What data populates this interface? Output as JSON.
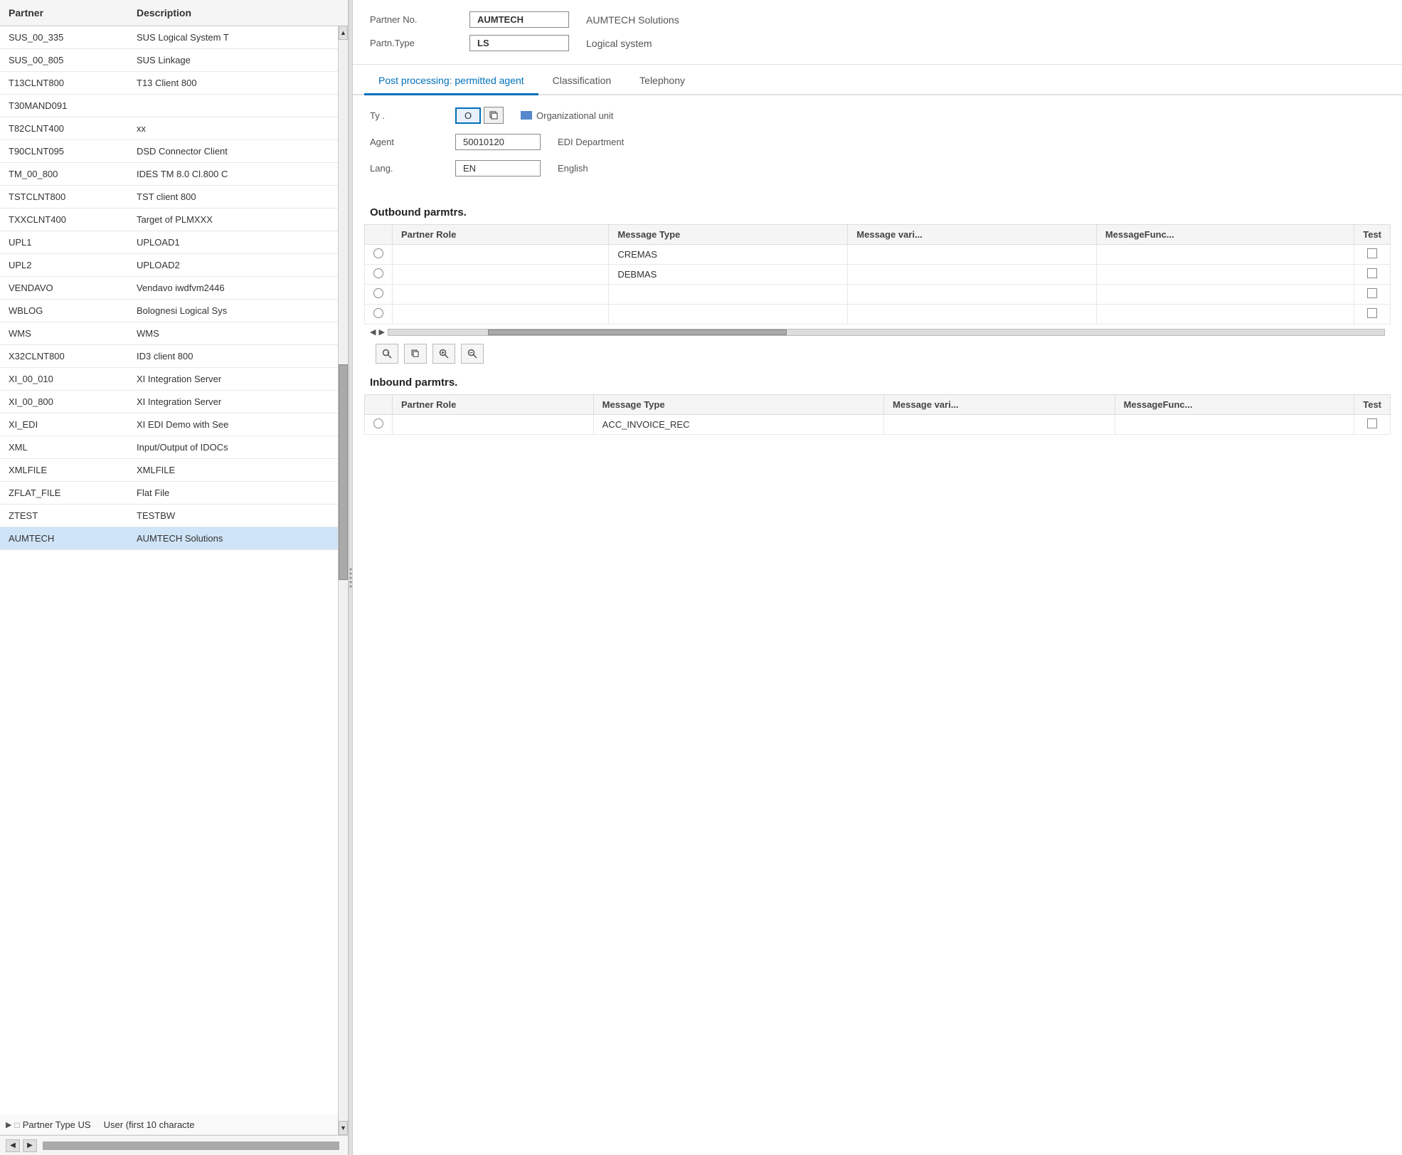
{
  "left_panel": {
    "col_partner": "Partner",
    "col_description": "Description",
    "rows": [
      {
        "partner": "SUS_00_335",
        "description": "SUS Logical System T"
      },
      {
        "partner": "SUS_00_805",
        "description": "SUS Linkage"
      },
      {
        "partner": "T13CLNT800",
        "description": "T13 Client 800"
      },
      {
        "partner": "T30MAND091",
        "description": ""
      },
      {
        "partner": "T82CLNT400",
        "description": "xx"
      },
      {
        "partner": "T90CLNT095",
        "description": "DSD Connector Client"
      },
      {
        "partner": "TM_00_800",
        "description": "IDES TM 8.0 Cl.800 C"
      },
      {
        "partner": "TSTCLNT800",
        "description": "TST client 800"
      },
      {
        "partner": "TXXCLNT400",
        "description": "Target of PLMXXX"
      },
      {
        "partner": "UPL1",
        "description": "UPLOAD1"
      },
      {
        "partner": "UPL2",
        "description": "UPLOAD2"
      },
      {
        "partner": "VENDAVO",
        "description": "Vendavo iwdfvm2446"
      },
      {
        "partner": "WBLOG",
        "description": "Bolognesi Logical Sys"
      },
      {
        "partner": "WMS",
        "description": "WMS"
      },
      {
        "partner": "X32CLNT800",
        "description": "ID3 client  800"
      },
      {
        "partner": "XI_00_010",
        "description": "XI  Integration Server"
      },
      {
        "partner": "XI_00_800",
        "description": "XI  Integration Server"
      },
      {
        "partner": "XI_EDI",
        "description": "XI EDI Demo with See"
      },
      {
        "partner": "XML",
        "description": "Input/Output of IDOCs"
      },
      {
        "partner": "XMLFILE",
        "description": "XMLFILE"
      },
      {
        "partner": "ZFLAT_FILE",
        "description": "Flat File"
      },
      {
        "partner": "ZTEST",
        "description": "TESTBW"
      },
      {
        "partner": "AUMTECH",
        "description": "AUMTECH Solutions",
        "selected": true
      }
    ],
    "partner_type_row": {
      "label": "Partner Type US",
      "description": "User (first 10 characte"
    }
  },
  "right_panel": {
    "partner_no_label": "Partner No.",
    "partner_no_value": "AUMTECH",
    "partner_no_text": "AUMTECH Solutions",
    "partn_type_label": "Partn.Type",
    "partn_type_value": "LS",
    "partn_type_text": "Logical system",
    "tabs": [
      {
        "label": "Post processing: permitted agent",
        "active": true
      },
      {
        "label": "Classification"
      },
      {
        "label": "Telephony"
      }
    ],
    "ty_label": "Ty .",
    "ty_value": "O",
    "ty_description": "Organizational unit",
    "agent_label": "Agent",
    "agent_value": "50010120",
    "agent_description": "EDI Department",
    "lang_label": "Lang.",
    "lang_value": "EN",
    "lang_description": "English",
    "outbound": {
      "title": "Outbound parmtrs.",
      "columns": [
        "Partner Role",
        "Message Type",
        "Message vari...",
        "MessageFunc...",
        "Test"
      ],
      "rows": [
        {
          "radio": "",
          "partner_role": "",
          "message_type": "CREMAS",
          "message_vari": "",
          "message_func": "",
          "test": ""
        },
        {
          "radio": "",
          "partner_role": "",
          "message_type": "DEBMAS",
          "message_vari": "",
          "message_func": "",
          "test": ""
        },
        {
          "radio": "",
          "partner_role": "",
          "message_type": "",
          "message_vari": "",
          "message_func": "",
          "test": ""
        },
        {
          "radio": "",
          "partner_role": "",
          "message_type": "",
          "message_vari": "",
          "message_func": "",
          "test": ""
        }
      ]
    },
    "toolbar": {
      "btn_search": "🔍",
      "btn_copy": "📋",
      "btn_zoom_in": "+",
      "btn_zoom_out": "−"
    },
    "inbound": {
      "title": "Inbound parmtrs.",
      "columns": [
        "Partner Role",
        "Message Type",
        "Message vari...",
        "MessageFunc...",
        "Test"
      ],
      "rows": [
        {
          "radio": "",
          "partner_role": "",
          "message_type": "ACC_INVOICE_REC",
          "message_vari": "",
          "message_func": "",
          "test": ""
        }
      ]
    }
  }
}
